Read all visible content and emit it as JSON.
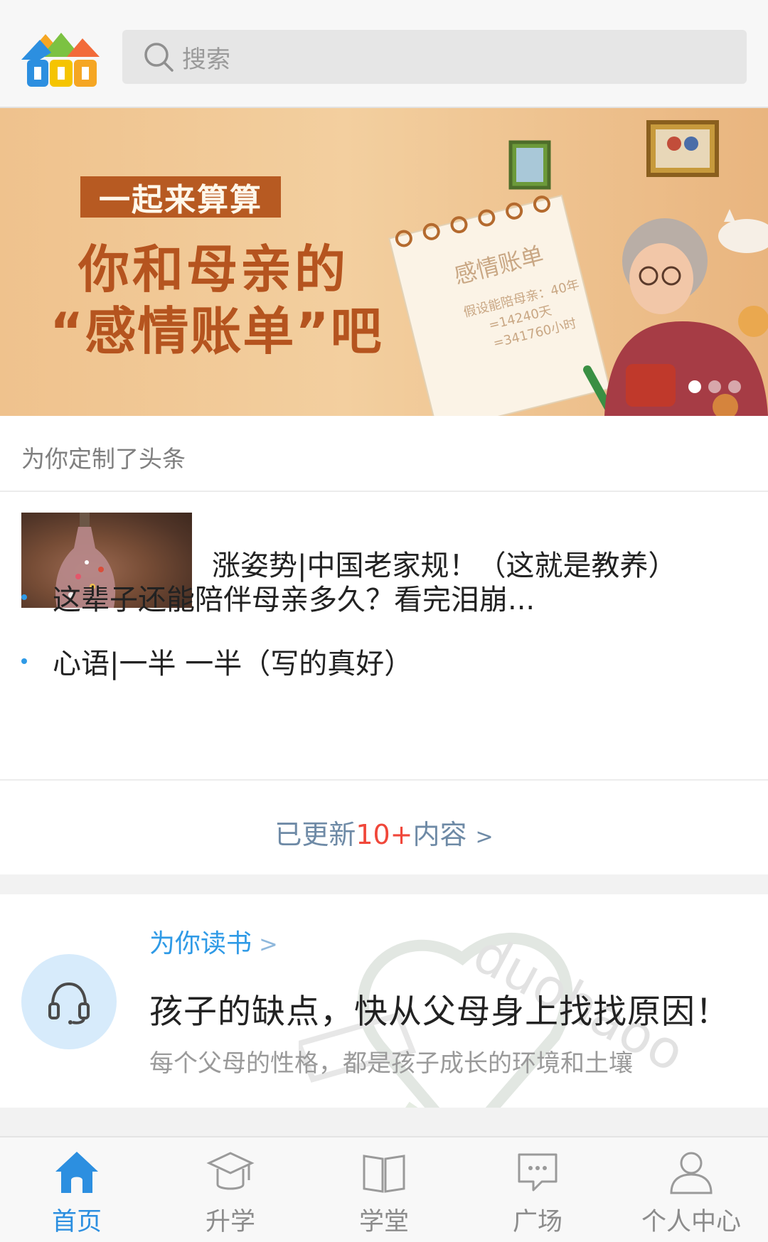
{
  "header": {
    "search_placeholder": "搜索",
    "logo_icon": "house-logo-icon"
  },
  "banner": {
    "tag": "一起来算算",
    "line1": "你和母亲的",
    "line2": "“感情账单”吧",
    "notebook": {
      "title": "感情账单",
      "line1": "假设能陪母亲：40年",
      "line2": "=14240天",
      "line3": "=341760小时"
    },
    "pages": 3,
    "current_page": 1
  },
  "headlines": {
    "section_title": "为你定制了头条",
    "main_title": "涨姿势|中国老家规！（这就是教养）",
    "items": [
      {
        "text": "这辈子还能陪伴母亲多久？看完泪崩..."
      },
      {
        "text": "心语|一半 一半（写的真好）"
      }
    ],
    "more_prefix": "已更新",
    "more_count": "10+",
    "more_suffix": "内容",
    "more_chevron": ">"
  },
  "reading": {
    "label": "为你读书",
    "label_chevron": ">",
    "title": "孩子的缺点，快从父母身上找找原因！",
    "subtitle": "每个父母的性格，都是孩子成长的环境和土壤",
    "watermark_text": "duohaoo",
    "icon": "headphones-icon"
  },
  "tabbar": {
    "items": [
      {
        "label": "首页",
        "icon": "home-icon",
        "active": true
      },
      {
        "label": "升学",
        "icon": "graduation-cap-icon",
        "active": false
      },
      {
        "label": "学堂",
        "icon": "open-book-icon",
        "active": false
      },
      {
        "label": "广场",
        "icon": "chat-bubble-icon",
        "active": false
      },
      {
        "label": "个人中心",
        "icon": "user-icon",
        "active": false
      }
    ]
  },
  "colors": {
    "accent_blue": "#2c8fe0",
    "banner_text": "#b5541f",
    "highlight_red": "#f0473a"
  }
}
